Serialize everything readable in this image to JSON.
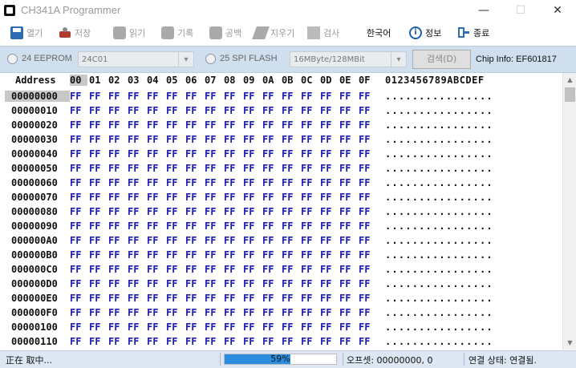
{
  "window": {
    "title": "CH341A Programmer",
    "min": "—",
    "max": "☐",
    "close": "✕"
  },
  "toolbar": [
    {
      "label": "열기",
      "icon": "save-disk-icon",
      "enabled": false
    },
    {
      "label": "저장",
      "icon": "save-icon",
      "enabled": false
    },
    {
      "label": "읽기",
      "icon": "read-chip-icon",
      "enabled": false
    },
    {
      "label": "기록",
      "icon": "write-chip-icon",
      "enabled": false
    },
    {
      "label": "공백",
      "icon": "blank-check-icon",
      "enabled": false
    },
    {
      "label": "지우기",
      "icon": "erase-icon",
      "enabled": false
    },
    {
      "label": "검사",
      "icon": "verify-icon",
      "enabled": false
    },
    {
      "label": "한국어",
      "icon": "",
      "enabled": true
    },
    {
      "label": "정보",
      "icon": "info-icon",
      "enabled": true
    },
    {
      "label": "종료",
      "icon": "exit-icon",
      "enabled": true
    }
  ],
  "chip": {
    "eeprom_label": "24 EEPROM",
    "eeprom_value": "24C01",
    "flash_label": "25 SPI FLASH",
    "flash_value": "16MByte/128MBit",
    "search_label": "검색(D)",
    "chip_info": "Chip Info: EF601817"
  },
  "grid": {
    "address_header": "Address",
    "columns": [
      "00",
      "01",
      "02",
      "03",
      "04",
      "05",
      "06",
      "07",
      "08",
      "09",
      "0A",
      "0B",
      "0C",
      "0D",
      "0E",
      "0F"
    ],
    "ascii_header": "0123456789ABCDEF",
    "byte_value": "FF",
    "ascii_row": "................",
    "rows": [
      "00000000",
      "00000010",
      "00000020",
      "00000030",
      "00000040",
      "00000050",
      "00000060",
      "00000070",
      "00000080",
      "00000090",
      "000000A0",
      "000000B0",
      "000000C0",
      "000000D0",
      "000000E0",
      "000000F0",
      "00000100",
      "00000110"
    ]
  },
  "status": {
    "left": "正在 取中...",
    "progress_percent": 59,
    "progress_text": "59%",
    "offset": "오프셋: 00000000, 0",
    "connection": "연결 상태: 연결됨."
  }
}
